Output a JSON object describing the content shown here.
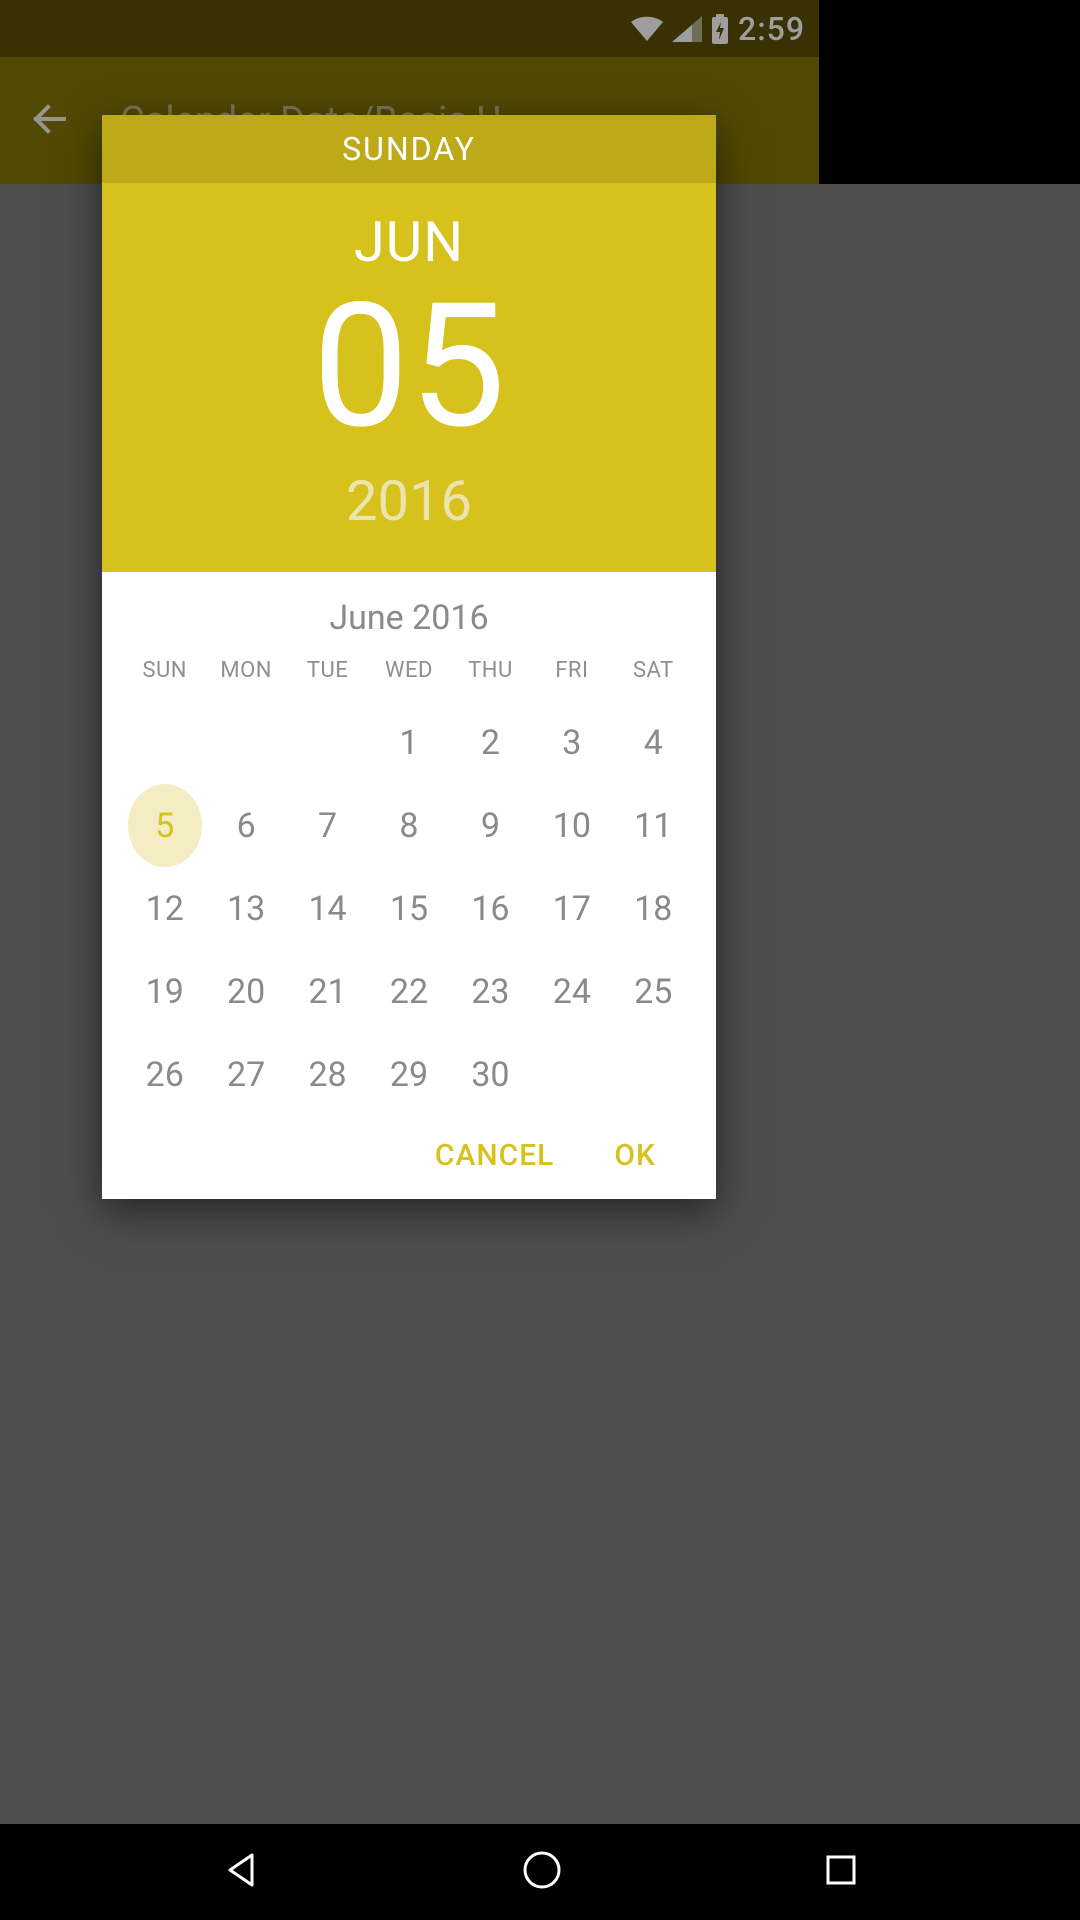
{
  "status": {
    "time": "2:59"
  },
  "appbar": {
    "title": "Calendar Date/Basic U..."
  },
  "picker": {
    "day_name": "SUNDAY",
    "month_short": "JUN",
    "day_num": "05",
    "year": "2016",
    "month_title": "June 2016",
    "weekdays": [
      "SUN",
      "MON",
      "TUE",
      "WED",
      "THU",
      "FRI",
      "SAT"
    ],
    "leading_blanks": 3,
    "days_in_month": 30,
    "selected_day": 5,
    "cancel_label": "CANCEL",
    "ok_label": "OK"
  }
}
